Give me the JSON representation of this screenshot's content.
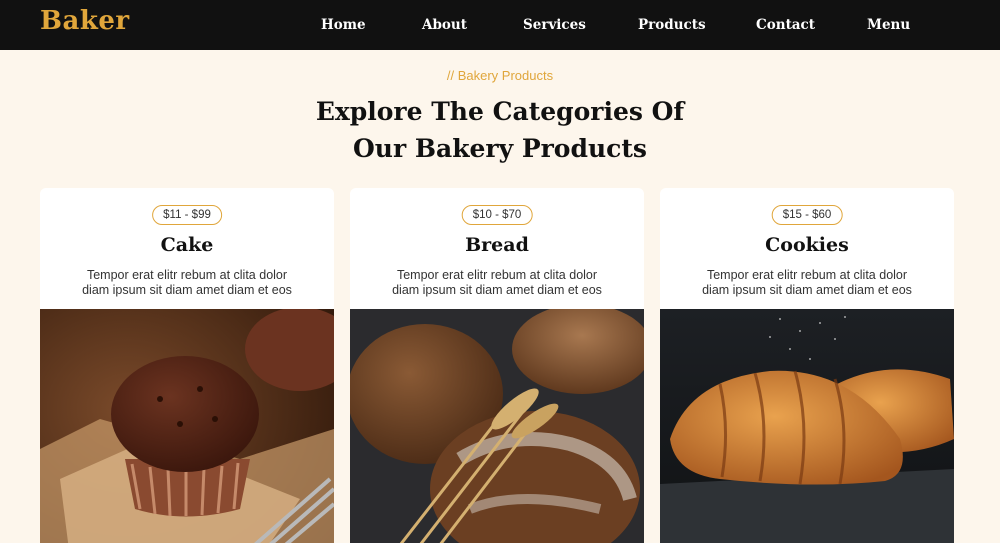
{
  "header": {
    "brand": "Baker",
    "nav": [
      "Home",
      "About",
      "Services",
      "Products",
      "Contact",
      "Menu"
    ]
  },
  "section": {
    "eyebrow": "// Bakery Products",
    "heading_line1": "Explore The Categories Of",
    "heading_line2": "Our Bakery Products"
  },
  "cards": [
    {
      "price": "$11 - $99",
      "title": "Cake",
      "desc_line1": "Tempor erat elitr rebum at clita dolor",
      "desc_line2": "diam ipsum sit diam amet diam et eos"
    },
    {
      "price": "$10 - $70",
      "title": "Bread",
      "desc_line1": "Tempor erat elitr rebum at clita dolor",
      "desc_line2": "diam ipsum sit diam amet diam et eos"
    },
    {
      "price": "$15 - $60",
      "title": "Cookies",
      "desc_line1": "Tempor erat elitr rebum at clita dolor",
      "desc_line2": "diam ipsum sit diam amet diam et eos"
    }
  ],
  "colors": {
    "accent": "#e0a63b",
    "header_bg": "#111111",
    "page_bg": "#fdf6ec"
  }
}
